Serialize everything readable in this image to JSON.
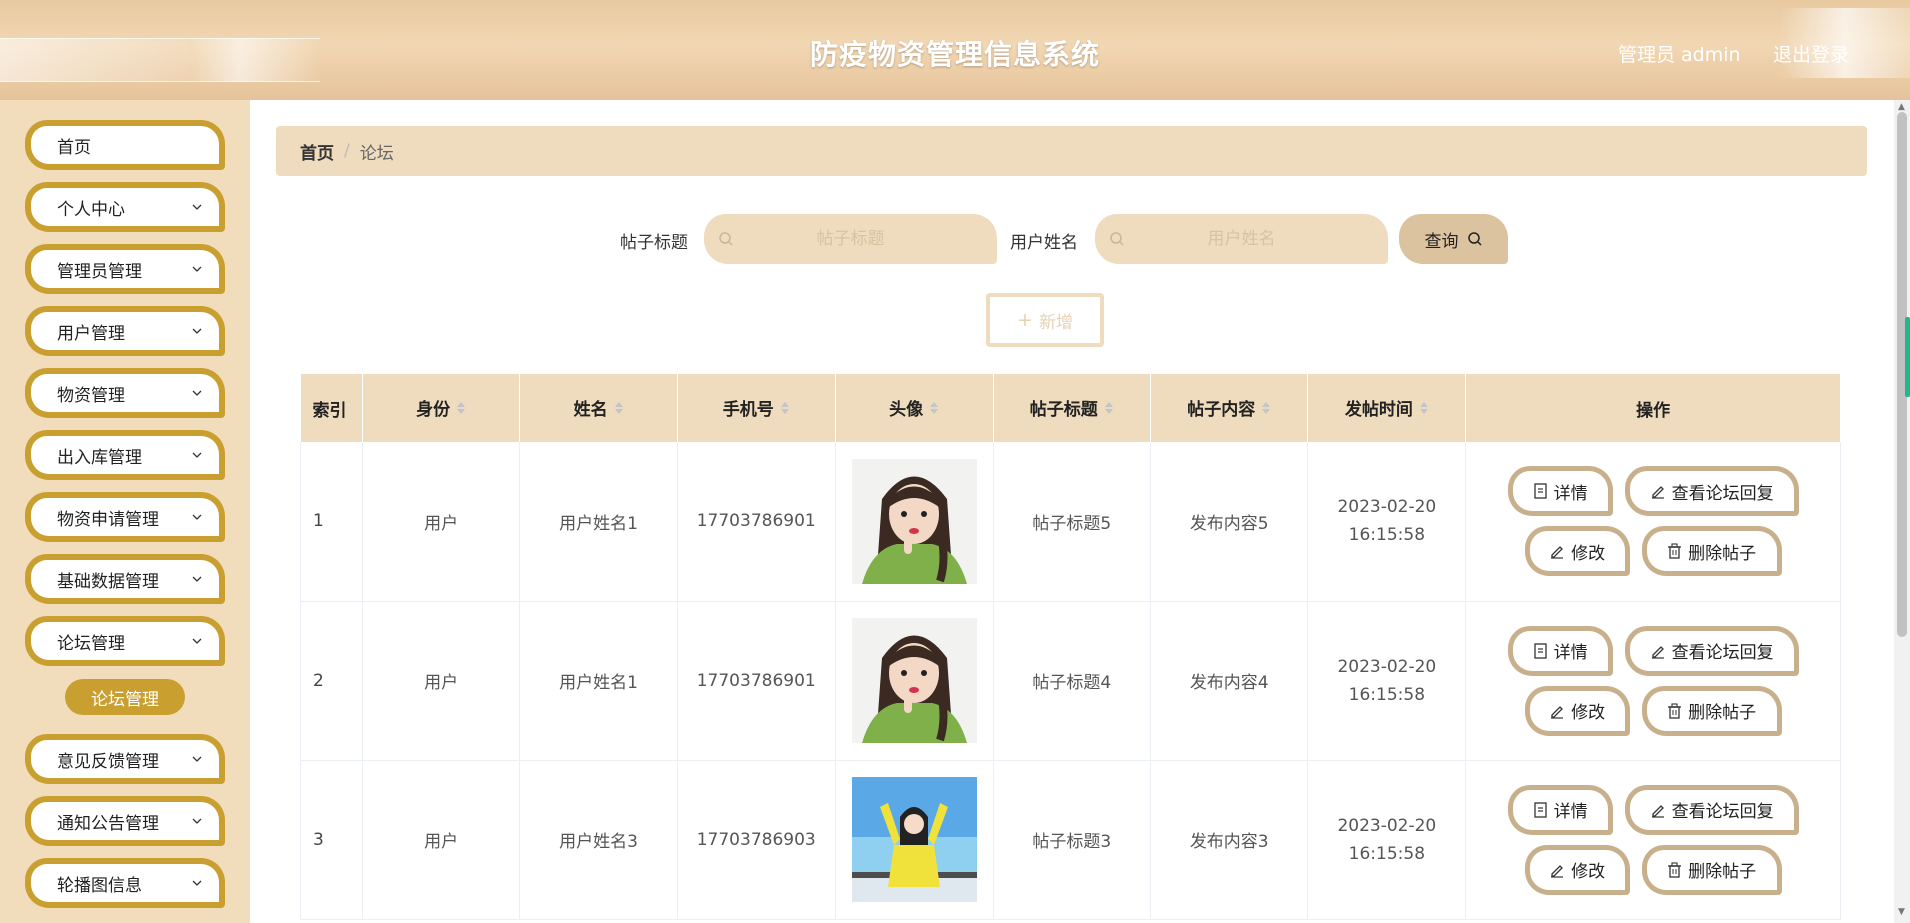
{
  "header": {
    "title": "防疫物资管理信息系统",
    "user_label": "管理员 admin",
    "logout_label": "退出登录"
  },
  "sidebar": {
    "items": [
      {
        "label": "首页",
        "has_chevron": false
      },
      {
        "label": "个人中心",
        "has_chevron": true
      },
      {
        "label": "管理员管理",
        "has_chevron": true
      },
      {
        "label": "用户管理",
        "has_chevron": true
      },
      {
        "label": "物资管理",
        "has_chevron": true
      },
      {
        "label": "出入库管理",
        "has_chevron": true
      },
      {
        "label": "物资申请管理",
        "has_chevron": true
      },
      {
        "label": "基础数据管理",
        "has_chevron": true
      },
      {
        "label": "论坛管理",
        "has_chevron": true
      },
      {
        "label": "意见反馈管理",
        "has_chevron": true
      },
      {
        "label": "通知公告管理",
        "has_chevron": true
      },
      {
        "label": "轮播图信息",
        "has_chevron": true
      }
    ],
    "active_sub_item": "论坛管理"
  },
  "breadcrumb": {
    "home": "首页",
    "separator": "/",
    "current": "论坛"
  },
  "search": {
    "title_label": "帖子标题",
    "title_placeholder": "帖子标题",
    "name_label": "用户姓名",
    "name_placeholder": "用户姓名",
    "query_label": "查询",
    "add_label": "新增"
  },
  "table": {
    "columns": [
      "索引",
      "身份",
      "姓名",
      "手机号",
      "头像",
      "帖子标题",
      "帖子内容",
      "发帖时间",
      "操作"
    ],
    "rows": [
      {
        "index": "1",
        "role": "用户",
        "name": "用户姓名1",
        "phone": "17703786901",
        "avatar": "avatar-green-sweater",
        "post_title": "帖子标题5",
        "post_content": "发布内容5",
        "post_time": "2023-02-20 16:15:58"
      },
      {
        "index": "2",
        "role": "用户",
        "name": "用户姓名1",
        "phone": "17703786901",
        "avatar": "avatar-green-sweater",
        "post_title": "帖子标题4",
        "post_content": "发布内容4",
        "post_time": "2023-02-20 16:15:58"
      },
      {
        "index": "3",
        "role": "用户",
        "name": "用户姓名3",
        "phone": "17703786903",
        "avatar": "avatar-beach-yellow",
        "post_title": "帖子标题3",
        "post_content": "发布内容3",
        "post_time": "2023-02-20 16:15:58"
      }
    ],
    "actions": {
      "detail": "详情",
      "view_replies": "查看论坛回复",
      "edit": "修改",
      "delete": "删除帖子"
    }
  },
  "colors": {
    "header_bg": "#edd0a8",
    "sidebar_bg": "#f1dcbc",
    "menu_border": "#c9a030",
    "table_header_bg": "#efdcbe",
    "action_border": "#c8b08c"
  }
}
